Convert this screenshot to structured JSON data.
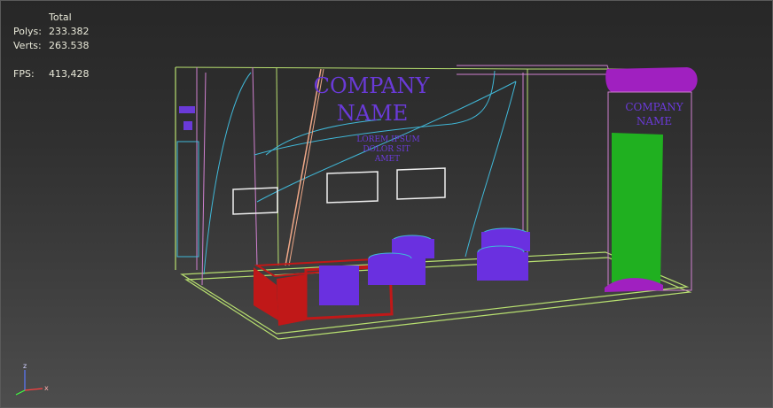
{
  "stats": {
    "header": "Total",
    "polys_label": "Polys:",
    "polys_value": "233.382",
    "verts_label": "Verts:",
    "verts_value": "263.538",
    "fps_label": "FPS:",
    "fps_value": "413,428"
  },
  "scene": {
    "wall_company": "COMPANY",
    "wall_name": "NAME",
    "wall_sub1": "LOREM IPSUM",
    "wall_sub2": "DOLOR SIT",
    "wall_sub3": "AMET",
    "totem_company": "COMPANY",
    "totem_name": "NAME"
  },
  "gizmo": {
    "axis_z": "z",
    "axis_x": "x"
  },
  "colors": {
    "background": "#2f2f2f",
    "frame_green": "#b8e070",
    "wire_pink": "#d080d0",
    "wire_cyan": "#40b8d8",
    "logo_purple": "#6a3ad8",
    "totem_green": "#20b020",
    "totem_magenta": "#a020c0",
    "counter_red": "#c01818",
    "chairs_purple": "#6a30e0"
  }
}
